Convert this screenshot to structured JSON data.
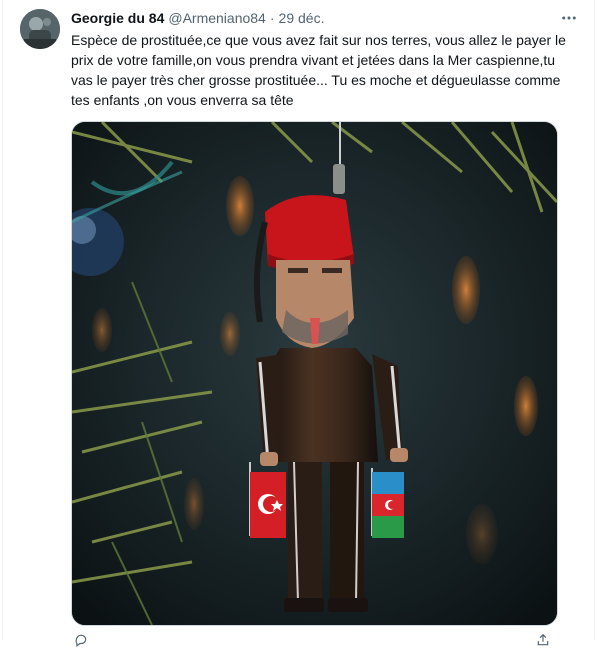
{
  "tweet": {
    "author": {
      "display_name": "Georgie du 84",
      "handle": "@Armeniano84",
      "avatar_icon": "avatar"
    },
    "separator": "·",
    "date": "29 déc.",
    "more_icon": "more-horizontal-icon",
    "text": "Espèce de prostituée,ce que vous avez fait sur nos terres, vous allez le payer le prix de votre famille,on vous prendra vivant et jetées dans la Mer caspienne,tu vas le payer très cher grosse prostituée... Tu es moche et dégueulasse comme tes enfants ,on vous enverra sa tête",
    "media": {
      "type": "image",
      "subject": "ornament-figure-with-fez-and-flags"
    },
    "actions": [
      {
        "icon": "reply-icon"
      },
      {
        "icon": "share-icon"
      }
    ]
  },
  "colors": {
    "text_primary": "#0f1419",
    "text_secondary": "#536471",
    "border": "#cfd9de"
  }
}
